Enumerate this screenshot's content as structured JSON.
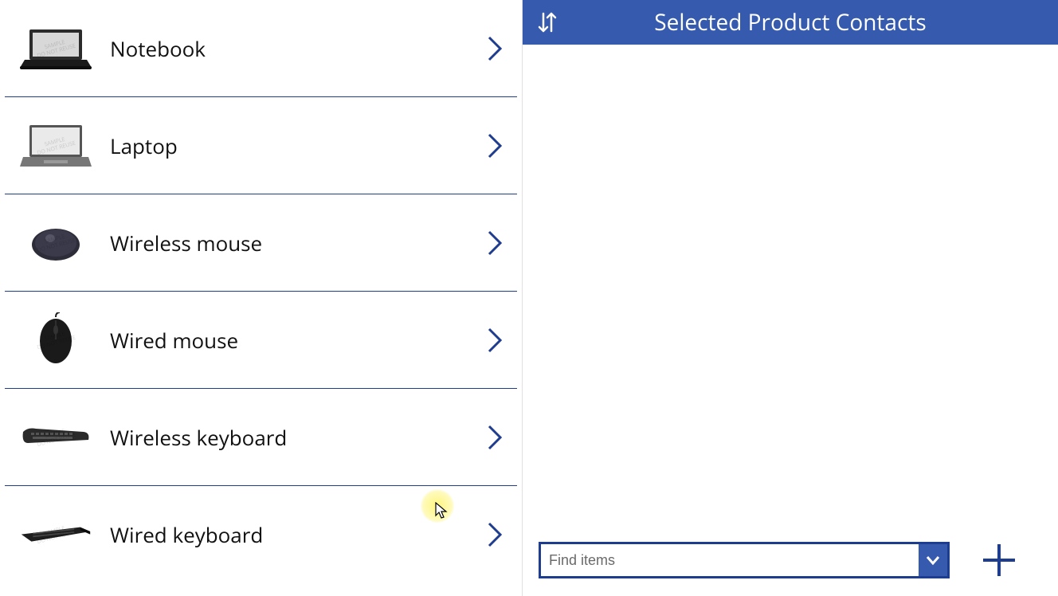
{
  "colors": {
    "accent": "#365aad",
    "divider": "#1f3d8f"
  },
  "left": {
    "products": [
      {
        "label": "Notebook",
        "thumb": "notebook"
      },
      {
        "label": "Laptop",
        "thumb": "laptop"
      },
      {
        "label": "Wireless mouse",
        "thumb": "wireless-mouse"
      },
      {
        "label": "Wired mouse",
        "thumb": "wired-mouse"
      },
      {
        "label": "Wireless keyboard",
        "thumb": "wireless-keyboard"
      },
      {
        "label": "Wired keyboard",
        "thumb": "wired-keyboard"
      }
    ]
  },
  "right": {
    "title": "Selected Product Contacts",
    "find_placeholder": "Find items"
  }
}
